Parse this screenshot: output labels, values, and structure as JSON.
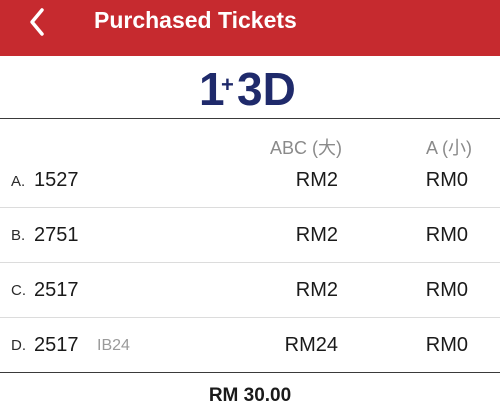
{
  "header": {
    "title": "Purchased Tickets",
    "back_icon": "chevron-left-icon",
    "color": "#c62a2f"
  },
  "logo": {
    "part1": "1",
    "plus": "+",
    "part2": "3D",
    "color": "#1f2a6b"
  },
  "columns": {
    "big": "ABC (大)",
    "small": "A (小)"
  },
  "tickets": [
    {
      "letter": "A.",
      "number": "1527",
      "type": "",
      "big": "RM2",
      "small": "RM0"
    },
    {
      "letter": "B.",
      "number": "2751",
      "type": "",
      "big": "RM2",
      "small": "RM0"
    },
    {
      "letter": "C.",
      "number": "2517",
      "type": "",
      "big": "RM2",
      "small": "RM0"
    },
    {
      "letter": "D.",
      "number": "2517",
      "type": "IB24",
      "big": "RM24",
      "small": "RM0"
    }
  ],
  "total": "RM 30.00"
}
